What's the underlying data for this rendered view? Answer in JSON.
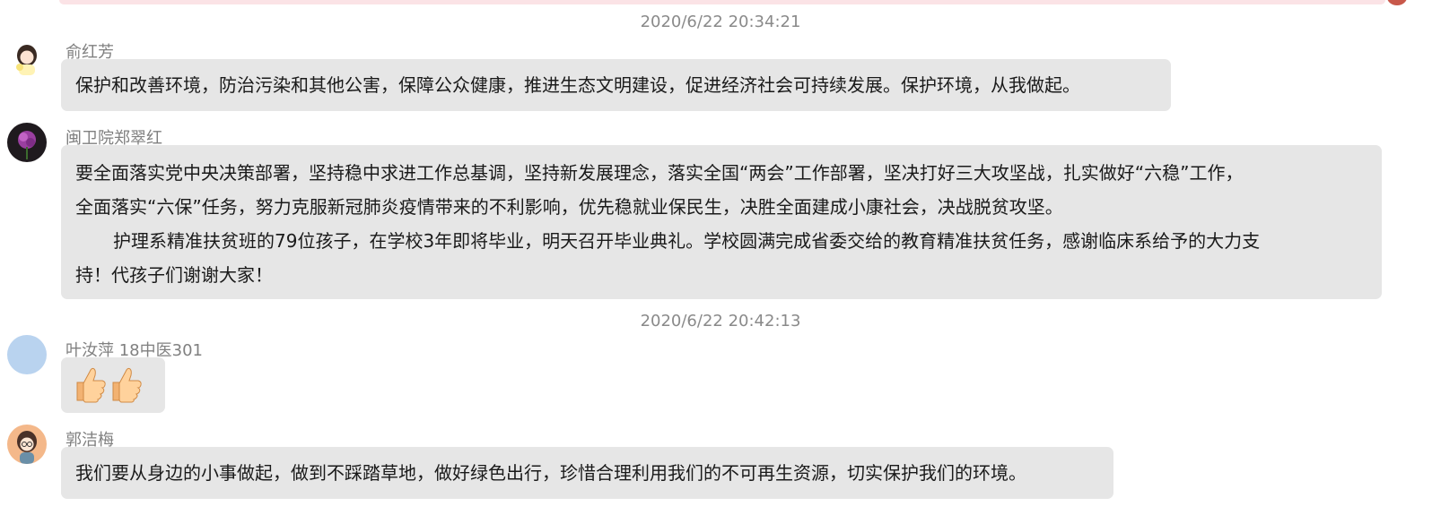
{
  "timestamps": [
    "2020/6/22 20:34:21",
    "2020/6/22 20:42:13"
  ],
  "messages": [
    {
      "sender": "俞红芳",
      "lines": [
        "保护和改善环境，防治污染和其他公害，保障公众健康，推进生态文明建设，促进经济社会可持续发展。保护环境，从我做起。"
      ]
    },
    {
      "sender": "闽卫院郑翠红",
      "lines": [
        "要全面落实党中央决策部署，坚持稳中求进工作总基调，坚持新发展理念，落实全国“两会”工作部署，坚决打好三大攻坚战，扎实做好“六稳”工作，",
        "全面落实“六保”任务，努力克服新冠肺炎疫情带来的不利影响，优先稳就业保民生，决胜全面建成小康社会，决战脱贫攻坚。",
        "护理系精准扶贫班的79位孩子，在学校3年即将毕业，明天召开毕业典礼。学校圆满完成省委交给的教育精准扶贫任务，感谢临床系给予的大力支",
        "持！代孩子们谢谢大家！"
      ]
    },
    {
      "sender": "叶汝萍 18中医301",
      "emoji": [
        "thumbs-up-icon",
        "thumbs-up-icon"
      ]
    },
    {
      "sender": "郭洁梅",
      "lines": [
        "我们要从身边的小事做起，做到不踩踏草地，做好绿色出行，珍惜合理利用我们的不可再生资源，切实保护我们的环境。"
      ]
    }
  ],
  "colors": {
    "bubble": "#e6e6e6",
    "timestamp": "#8a8a8a",
    "sender": "#808080",
    "text": "#1a1a1a"
  }
}
